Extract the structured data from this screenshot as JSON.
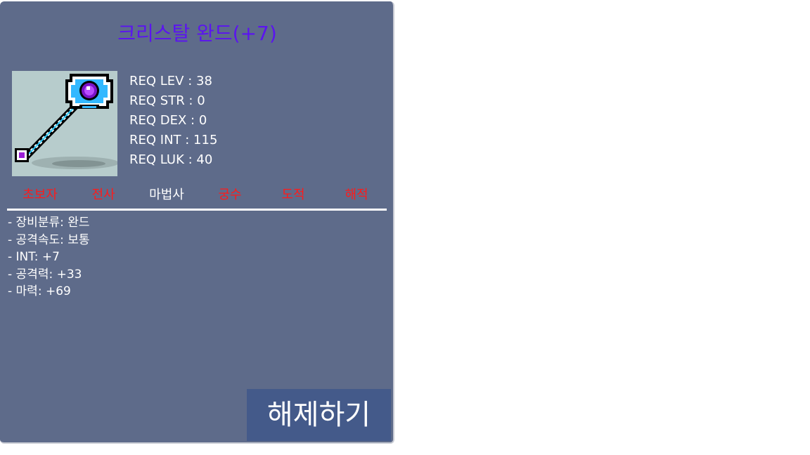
{
  "item": {
    "name": "크리스탈 완드(+7)",
    "icon": "crystal-wand-icon"
  },
  "requirements": [
    "REQ LEV : 38",
    "REQ STR : 0",
    "REQ DEX : 0",
    "REQ INT : 115",
    "REQ LUK : 40"
  ],
  "jobs": [
    {
      "label": "초보자",
      "usable": false
    },
    {
      "label": "전사",
      "usable": false
    },
    {
      "label": "마법사",
      "usable": true
    },
    {
      "label": "궁수",
      "usable": false
    },
    {
      "label": "도적",
      "usable": false
    },
    {
      "label": "해적",
      "usable": false
    }
  ],
  "stats": [
    "- 장비분류: 완드",
    "- 공격속도: 보통",
    "- INT: +7",
    "- 공격력: +33",
    "- 마력: +69"
  ],
  "buttons": {
    "release_label": "해제하기"
  },
  "colors": {
    "panel_bg": "#5e6b8a",
    "title": "#5b14f0",
    "job_unavailable": "#ff1a1a",
    "job_available": "#ffffff",
    "button_bg": "#445a8a"
  }
}
